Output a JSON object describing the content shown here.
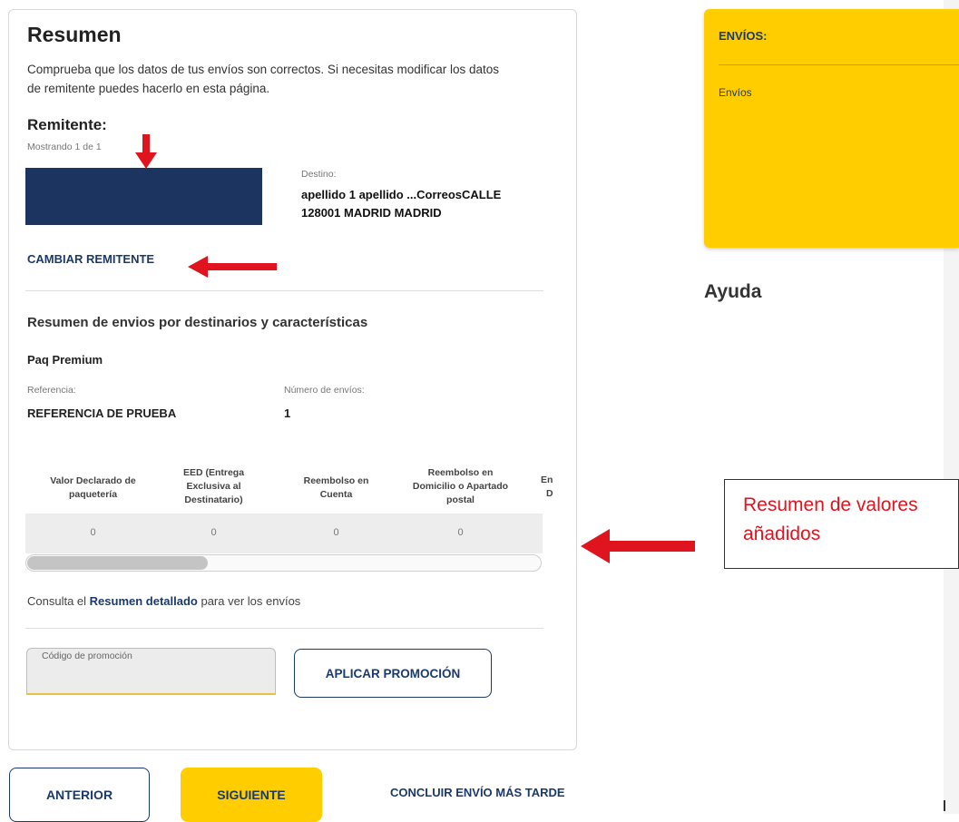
{
  "summary": {
    "title": "Resumen",
    "intro_line1": "Comprueba que los datos de tus envíos son correctos. Si necesitas modificar los datos",
    "intro_line2": "de remitente puedes hacerlo en esta página."
  },
  "sender": {
    "label": "Remitente:",
    "showing": "Mostrando 1 de 1",
    "destination_label": "Destino:",
    "destination_line1": "apellido 1 apellido ...CorreosCALLE",
    "destination_line2": "128001  MADRID MADRID",
    "change_link": "CAMBIAR REMITENTE"
  },
  "shipments": {
    "title": "Resumen de envios por destinarios y características",
    "product": "Paq Premium",
    "reference_label": "Referencia:",
    "reference_value": "REFERENCIA DE PRUEBA",
    "count_label": "Número de envíos:",
    "count_value": "1"
  },
  "values_table": {
    "headers": [
      [
        "Valor Declarado de",
        "paquetería"
      ],
      [
        "EED (Entrega",
        "Exclusiva al",
        "Destinatario)"
      ],
      [
        "Reembolso en",
        "Cuenta"
      ],
      [
        "Reembolso en",
        "Domicilio o Apartado",
        "postal"
      ],
      [
        "En",
        "D"
      ]
    ],
    "row": [
      "0",
      "0",
      "0",
      "0"
    ],
    "scroll_position": 0
  },
  "detail_link": {
    "prefix": "Consulta el ",
    "link": "Resumen detallado",
    "suffix": " para ver los envíos"
  },
  "promo": {
    "placeholder": "Código de promoción",
    "value": "",
    "apply_button": "APLICAR PROMOCIÓN"
  },
  "footer": {
    "prev_button": "ANTERIOR",
    "next_button": "SIGUIENTE",
    "later_link": "CONCLUIR ENVÍO MÁS TARDE"
  },
  "sidebar": {
    "envios_title": "ENVÍOS:",
    "envios_item": "Envíos",
    "help_title": "Ayuda"
  },
  "annotation": {
    "text_line1": "Resumen de valores",
    "text_line2": "añadidos"
  },
  "colors": {
    "brand_blue": "#1b3a6b",
    "brand_yellow": "#ffcd00",
    "annotation_red": "#e0141e"
  }
}
